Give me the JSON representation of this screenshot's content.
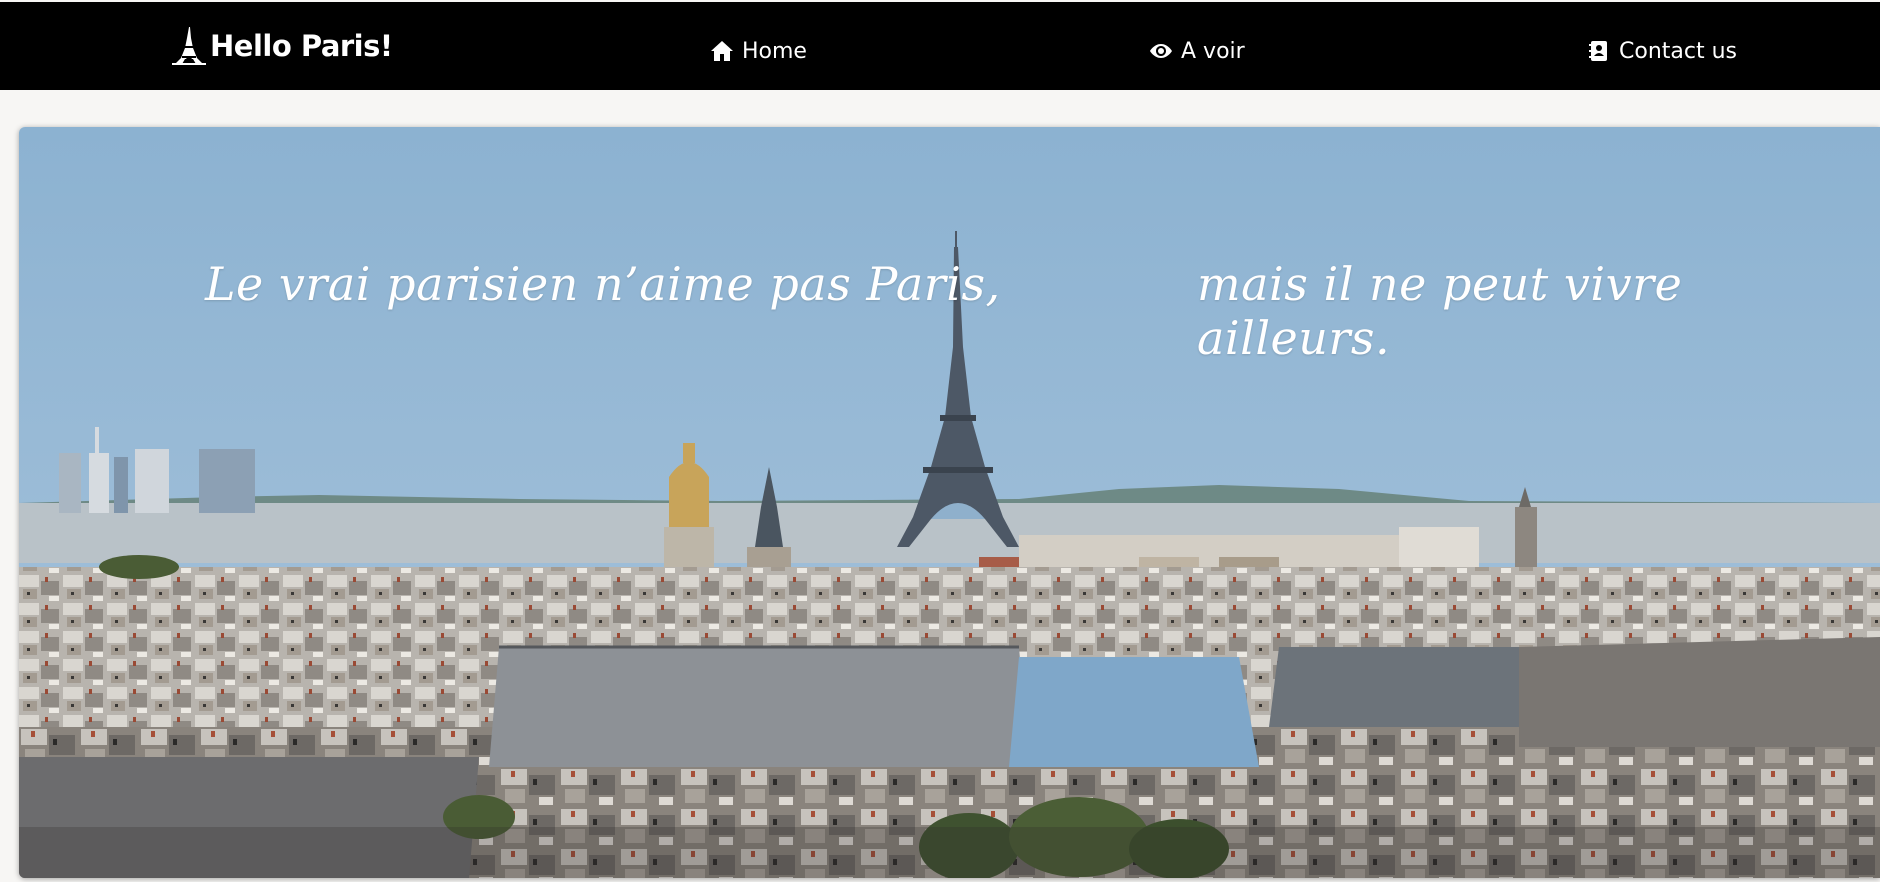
{
  "navbar": {
    "brand": {
      "label": "Hello Paris!",
      "icon": "eiffel-tower-icon"
    },
    "items": [
      {
        "label": "Home",
        "icon": "home-icon"
      },
      {
        "label": "A voir",
        "icon": "eye-icon"
      },
      {
        "label": "Contact us",
        "icon": "address-book-icon"
      }
    ]
  },
  "hero": {
    "quote_part1": "Le vrai parisien n’aime pas Paris,",
    "quote_part2": "mais il ne peut vivre ailleurs."
  },
  "colors": {
    "navbar_bg": "#000000",
    "sky": "#8fb3d0",
    "text": "#ffffff"
  }
}
